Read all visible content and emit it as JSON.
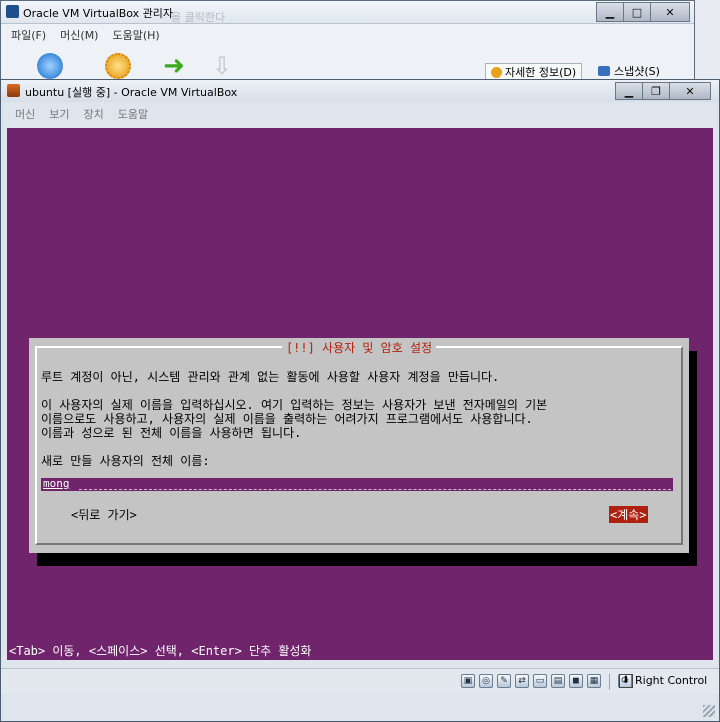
{
  "manager": {
    "title": "Oracle VM VirtualBox 관리자",
    "bg_hint": "을 클릭한다",
    "menu": [
      "파일(F)",
      "머신(M)",
      "도움말(H)"
    ],
    "details_label": "자세한 정보(D)",
    "snapshots_label": "스냅샷(S)"
  },
  "vm": {
    "title": "ubuntu [실행 중] - Oracle VM VirtualBox",
    "menu": [
      "머신",
      "보기",
      "장치",
      "도움말"
    ]
  },
  "dialog": {
    "title": "[!!] 사용자 및 암호 설정",
    "line1": "루트 계정이 아닌, 시스템 관리와 관계 없는 활동에 사용할 사용자 계정을 만듭니다.",
    "line2": "이 사용자의 실제 이름을 입력하십시오. 여기 입력하는 정보는 사용자가 보낸 전자메일의 기본",
    "line3": "이름으로도 사용하고, 사용자의 실제 이름을 출력하는 어려가지 프로그램에서도 사용합니다.",
    "line4": "이름과 성으로 된 전체 이름을 사용하면 됩니다.",
    "prompt": "새로 만들 사용자의 전체 이름:",
    "input_value": "mong",
    "back_label": "<뒤로 가기>",
    "continue_label": "<계속>"
  },
  "footer_hint": "<Tab> 이동, <스페이스> 선택, <Enter> 단추 활성화",
  "status": {
    "host_key": "Right Control"
  },
  "colors": {
    "screen_bg": "#70246c",
    "dialog_bg": "#c4c4c4",
    "accent_red": "#b0200e"
  }
}
